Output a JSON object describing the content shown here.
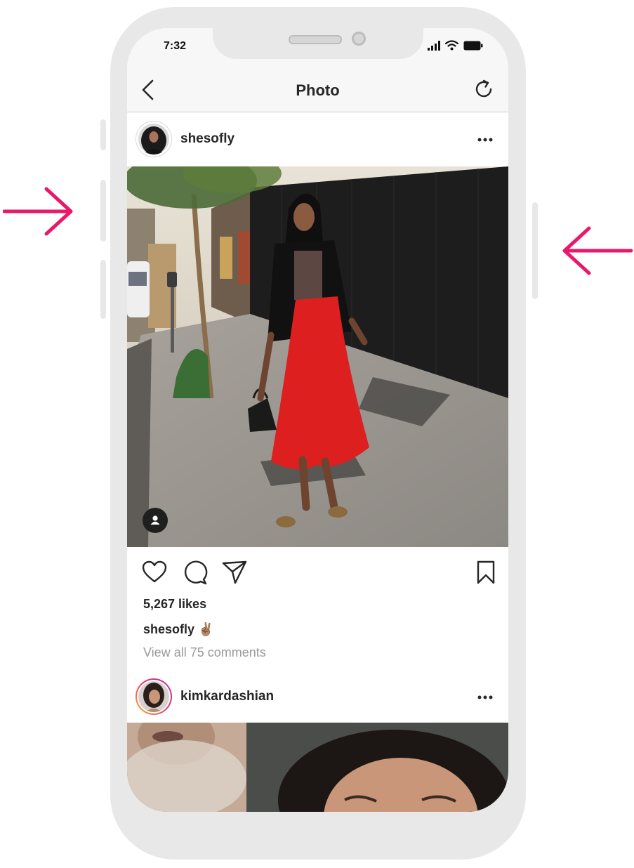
{
  "status_bar": {
    "time": "7:32",
    "icons": [
      "signal-icon",
      "wifi-icon",
      "battery-icon"
    ]
  },
  "nav_bar": {
    "title": "Photo",
    "back_icon": "chevron-left-icon",
    "refresh_icon": "refresh-icon"
  },
  "post": {
    "username": "shesofly",
    "more_icon": "more-horizontal-icon",
    "tag_icon": "tagged-user-icon",
    "actions": [
      "heart-icon",
      "comment-icon",
      "share-icon",
      "bookmark-icon"
    ],
    "likes": "5,267 likes",
    "caption_user": "shesofly",
    "caption_text": "✌🏽",
    "comments_link": "View all 75 comments"
  },
  "next_post": {
    "username": "kimkardashian",
    "more_icon": "more-horizontal-icon"
  },
  "annotations": {
    "left_arrow": "arrow-right-icon",
    "right_arrow": "arrow-left-icon",
    "arrow_color": "#e8186b"
  },
  "colors": {
    "text": "#262626",
    "secondary_text": "#9a9a9a",
    "frame": "#e8e8e8",
    "nav_background": "#f7f7f7"
  }
}
